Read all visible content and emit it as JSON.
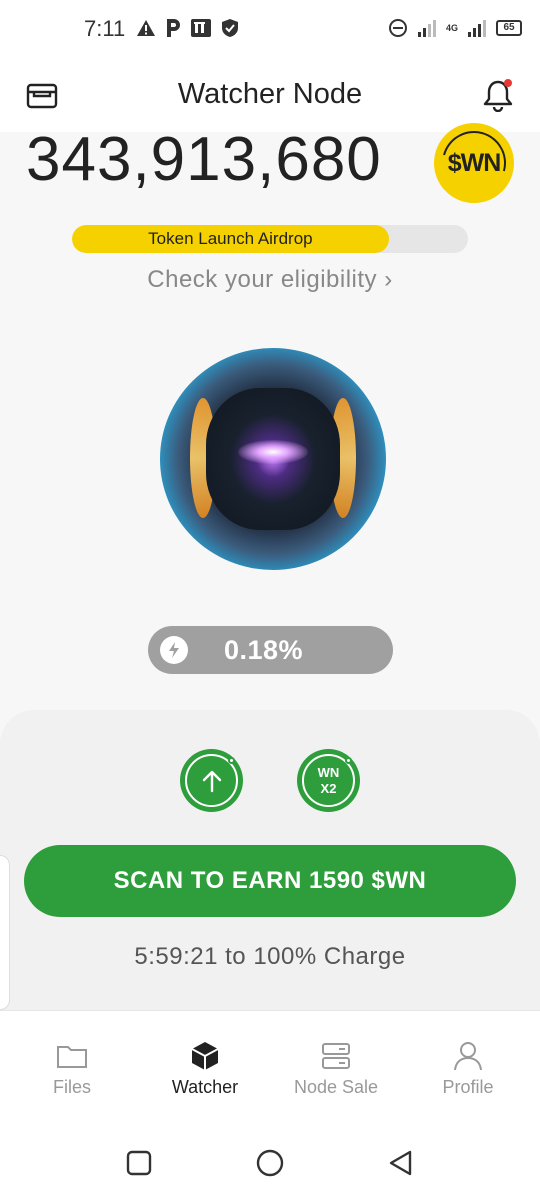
{
  "status_bar": {
    "time": "7:11",
    "network": "4G",
    "battery": "65",
    "left_icons": [
      "warning-icon",
      "parking-icon",
      "pi-app-icon",
      "shield-icon"
    ],
    "right_icons": [
      "dnd-icon",
      "signal-icon",
      "signal-icon",
      "battery-icon"
    ]
  },
  "header": {
    "title": "Watcher Node",
    "left_icon": "wallet-icon",
    "right_icon": "bell-icon",
    "notification_dot_color": "#e53935"
  },
  "balance": {
    "amount": "343,913,680",
    "coin_label": "$WN",
    "coin_color": "#f6d100"
  },
  "airdrop": {
    "label": "Token Launch Airdrop",
    "progress_fraction": 0.8,
    "eligibility_text": "Check your eligibility",
    "chevron": "›"
  },
  "charge": {
    "icon": "lightning-icon",
    "value": "0.18%"
  },
  "actions": {
    "boost_label_line1": "WN",
    "boost_label_line2": "X2",
    "upgrade_icon": "arrow-up-icon",
    "scan_button": "SCAN TO EARN 1590 $WN",
    "countdown": "5:59:21 to 100% Charge",
    "accent": "#2e9e3c"
  },
  "nav": {
    "items": [
      {
        "label": "Files",
        "icon": "folder-icon"
      },
      {
        "label": "Watcher",
        "icon": "cube-icon"
      },
      {
        "label": "Node Sale",
        "icon": "server-icon"
      },
      {
        "label": "Profile",
        "icon": "person-icon"
      }
    ],
    "active_index": 1
  },
  "system_nav": [
    "square-icon",
    "circle-icon",
    "back-triangle-icon"
  ]
}
